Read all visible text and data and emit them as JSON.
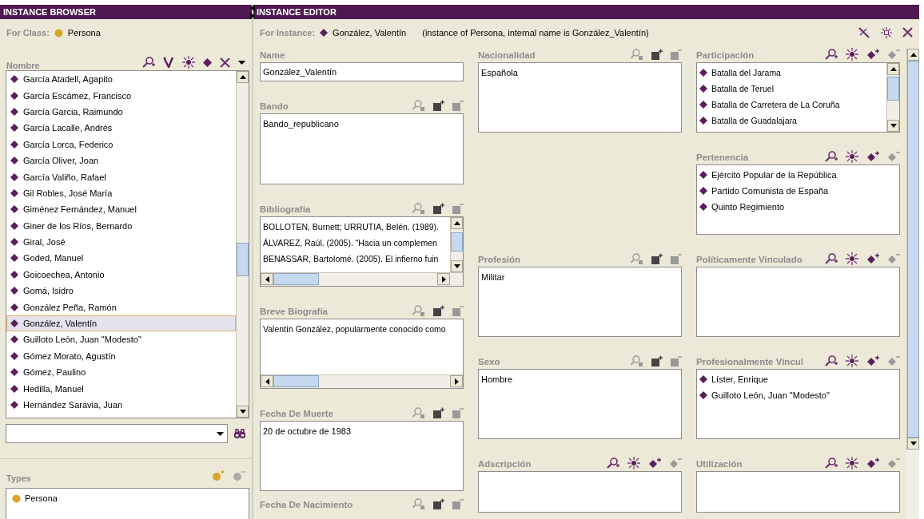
{
  "browser": {
    "title": "INSTANCE BROWSER",
    "for_class_label": "For Class:",
    "class_name": "Persona",
    "list_header": "Nombre",
    "instances": [
      {
        "name": "García Atadell, Agapito",
        "selected": false
      },
      {
        "name": "García Escámez, Francisco",
        "selected": false
      },
      {
        "name": "García Garcia, Raimundo",
        "selected": false
      },
      {
        "name": "García Lacalle, Andrés",
        "selected": false
      },
      {
        "name": "García Lorca, Federico",
        "selected": false
      },
      {
        "name": "García Oliver, Joan",
        "selected": false
      },
      {
        "name": "García Valiño, Rafael",
        "selected": false
      },
      {
        "name": "Gil Robles, José María",
        "selected": false
      },
      {
        "name": "Giménez Fernández, Manuel",
        "selected": false
      },
      {
        "name": "Giner de los Ríos, Bernardo",
        "selected": false
      },
      {
        "name": "Giral, José",
        "selected": false
      },
      {
        "name": "Goded, Manuel",
        "selected": false
      },
      {
        "name": "Goicoechea, Antonio",
        "selected": false
      },
      {
        "name": "Gomá, Isidro",
        "selected": false
      },
      {
        "name": "González Peña, Ramón",
        "selected": false
      },
      {
        "name": "González, Valentín",
        "selected": true
      },
      {
        "name": "Guilloto León, Juan \"Modesto\"",
        "selected": false
      },
      {
        "name": "Gómez Morato, Agustín",
        "selected": false
      },
      {
        "name": "Gómez, Paulino",
        "selected": false
      },
      {
        "name": "Hedilla, Manuel",
        "selected": false
      },
      {
        "name": "Hernández Saravia, Juan",
        "selected": false
      }
    ],
    "types_header": "Types",
    "types": [
      "Persona"
    ]
  },
  "editor": {
    "title": "INSTANCE EDITOR",
    "for_instance_label": "For Instance:",
    "instance_name": "González, Valentín",
    "instance_note": "(instance of Persona, internal name is González_Valentín)",
    "columns": [
      [
        {
          "label": "Name",
          "kind": "string",
          "values": [
            "González_Valentín"
          ]
        },
        {
          "label": "Bando",
          "kind": "value",
          "values": [
            "Bando_republicano"
          ]
        },
        {
          "label": "Bibliografía",
          "kind": "value",
          "values": [
            "BOLLOTEN, Burnett; URRUTIA, Belén. (1989).",
            "ÁLVAREZ, Raúl. (2005). “Hacia un complemen",
            "BENASSAR, Bartolomé. (2005). El infierno fuin"
          ]
        },
        {
          "label": "Breve Biografía",
          "kind": "value",
          "values": [
            "Valentín González, popularmente conocido como"
          ]
        },
        {
          "label": "Fecha De Muerte",
          "kind": "value",
          "values": [
            "20 de octubre de 1983"
          ]
        },
        {
          "label": "Fecha De Nacimiento",
          "kind": "value"
        }
      ],
      [
        {
          "label": "Nacionalidad",
          "kind": "value",
          "values": [
            "Española"
          ]
        },
        {
          "label": "Profesión",
          "kind": "value",
          "values": [
            "Militar"
          ]
        },
        {
          "label": "Sexo",
          "kind": "value",
          "values": [
            "Hombre"
          ]
        },
        {
          "label": "Adscripción",
          "kind": "instance"
        }
      ],
      [
        {
          "label": "Participación",
          "kind": "instance",
          "values": [
            "Batalla del Jarama",
            "Batalla de Teruel",
            "Batalla de Carretera de La Coruña",
            "Batalla de Guadalajara"
          ]
        },
        {
          "label": "Pertenencia",
          "kind": "instance",
          "values": [
            "Ejército Popular de la República",
            "Partido Comunista de España",
            "Quinto Regimiento"
          ]
        },
        {
          "label": "Políticamente Vinculado",
          "kind": "instance"
        },
        {
          "label": "Profesionalmente Vincul",
          "kind": "instance",
          "values": [
            "Líster, Enrique",
            "Guilloto León, Juan \"Modesto\""
          ]
        },
        {
          "label": "Utilización",
          "kind": "instance"
        }
      ]
    ]
  }
}
